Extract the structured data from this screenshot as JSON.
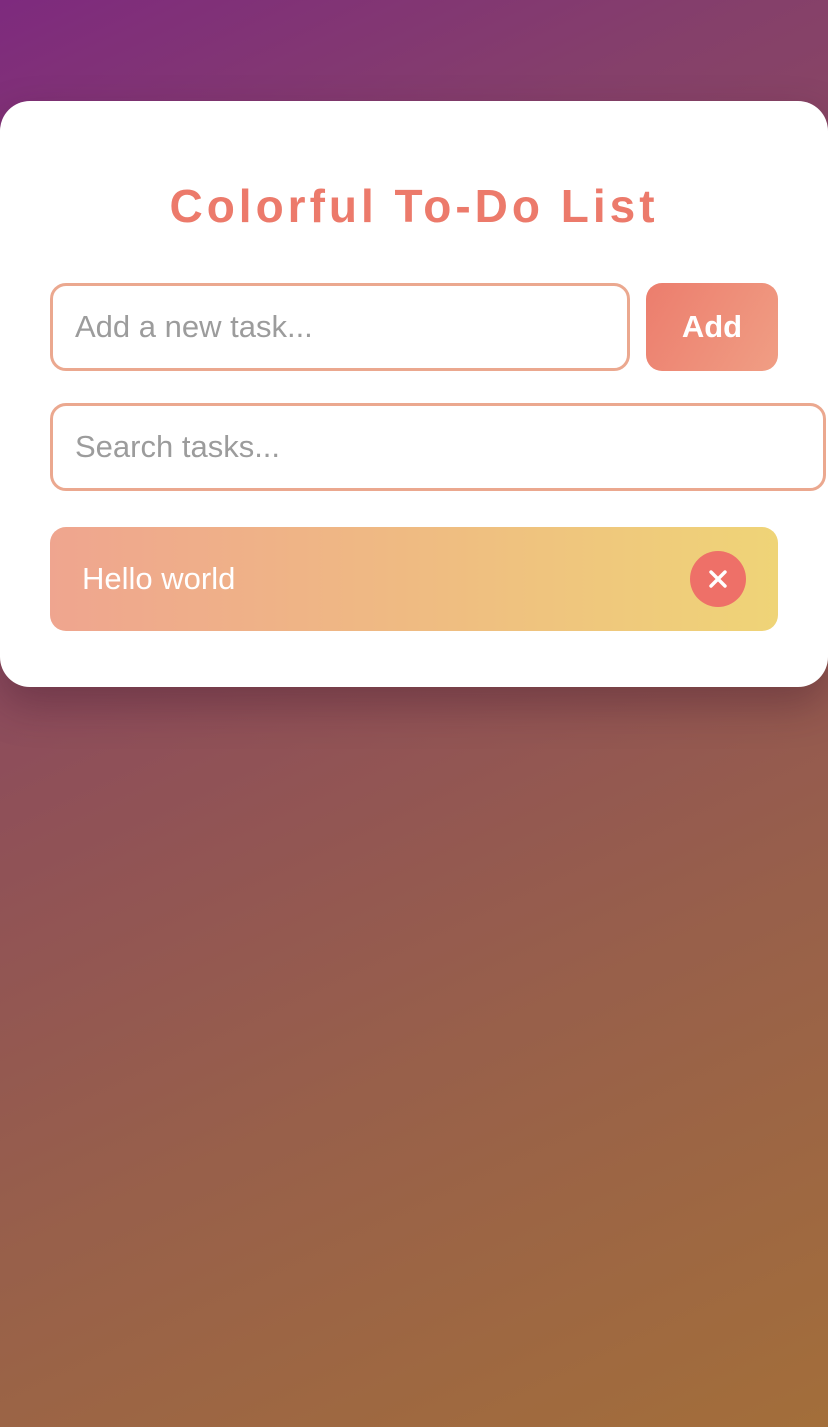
{
  "app": {
    "title": "Colorful To-Do List"
  },
  "new_task": {
    "placeholder": "Add a new task...",
    "value": "",
    "add_label": "Add"
  },
  "search": {
    "placeholder": "Search tasks...",
    "value": ""
  },
  "tasks": [
    {
      "text": "Hello world",
      "delete_icon": "close-icon"
    }
  ],
  "colors": {
    "accent": "#ec7a6b",
    "input_border": "#eba88f",
    "delete_button": "#ee7068",
    "task_gradient_start": "#efa58f",
    "task_gradient_end": "#efd477"
  }
}
